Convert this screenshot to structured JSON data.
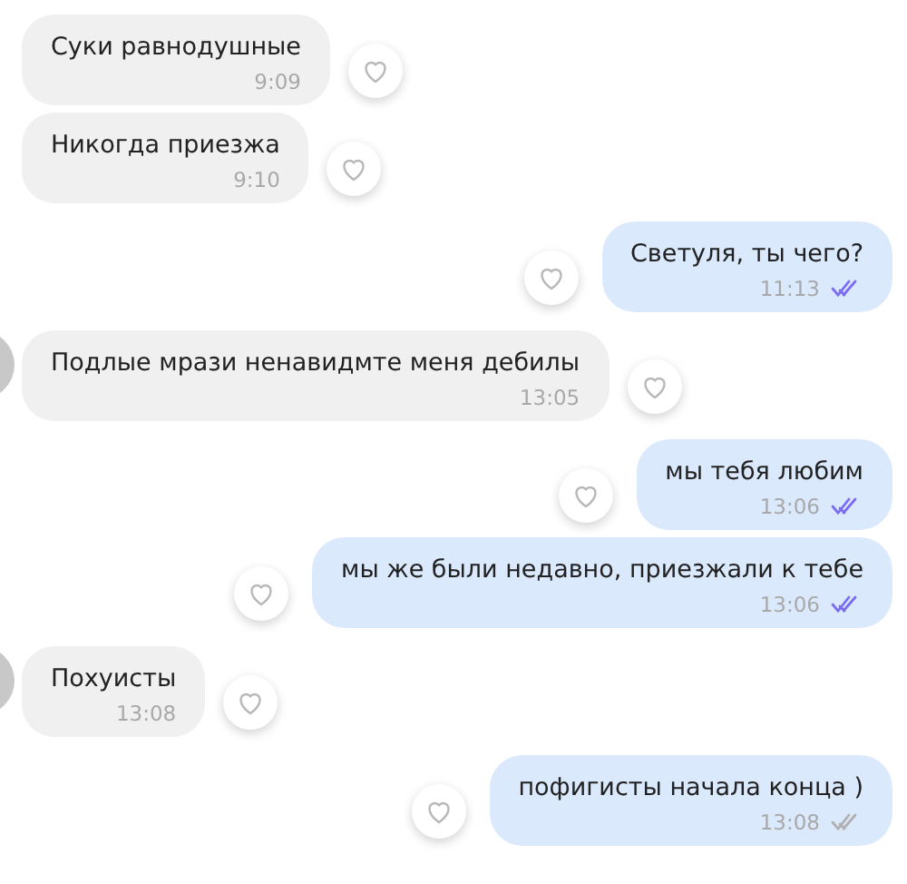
{
  "messages": [
    {
      "kind": "incoming",
      "avatar": false,
      "text": "Суки равнодушные",
      "time": "9:09"
    },
    {
      "kind": "incoming",
      "avatar": false,
      "text": "Никогда приезжа",
      "time": "9:10"
    },
    {
      "kind": "outgoing",
      "text": "Светуля, ты чего?",
      "time": "11:13",
      "read": true
    },
    {
      "kind": "incoming",
      "avatar": true,
      "text": "Подлые мрази ненавидмте меня дебилы",
      "time": "13:05"
    },
    {
      "kind": "outgoing",
      "text": "мы тебя любим",
      "time": "13:06",
      "read": true
    },
    {
      "kind": "outgoing",
      "text": "мы же были недавно, приезжали к тебе",
      "time": "13:06",
      "read": true
    },
    {
      "kind": "incoming",
      "avatar": true,
      "text": "Похуисты",
      "time": "13:08"
    },
    {
      "kind": "outgoing",
      "text": "пофигисты начала конца )",
      "time": "13:08",
      "read": false
    }
  ]
}
